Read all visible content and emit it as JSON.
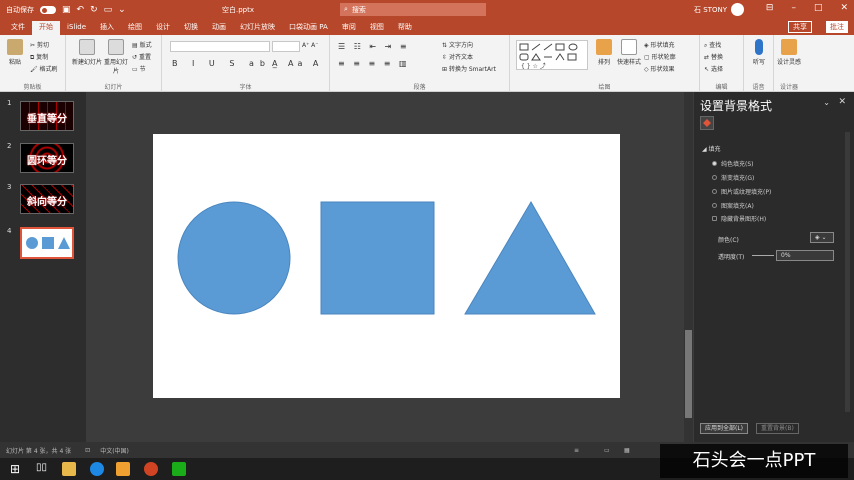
{
  "app": {
    "title": "空白.pptx",
    "user": "石 STONY",
    "search_placeholder": "搜索",
    "autosave_label": "自动保存"
  },
  "tabs": [
    "文件",
    "开始",
    "iSlide",
    "插入",
    "绘图",
    "设计",
    "切换",
    "动画",
    "幻灯片放映",
    "口袋动画 PA",
    "审阅",
    "视图",
    "帮助"
  ],
  "active_tab": "开始",
  "actions": {
    "share": "共享",
    "comment": "批注"
  },
  "ribbon": {
    "groups": [
      "剪贴板",
      "幻灯片",
      "字体",
      "段落",
      "绘图",
      "编辑"
    ],
    "clipboard": {
      "paste": "粘贴",
      "cut": "剪切",
      "copy": "复制",
      "format_painter": "格式刷"
    },
    "slides": {
      "new_slide": "新建幻灯片",
      "reuse": "重用幻灯片",
      "layout": "版式",
      "reset": "重置",
      "section": "节"
    },
    "paragraph": {
      "text_direction": "文字方向",
      "align_text": "对齐文本",
      "smartart": "转换为 SmartArt"
    },
    "drawing": {
      "arrange": "排列",
      "quick_styles": "快速样式",
      "shape_fill": "形状填充",
      "shape_outline": "形状轮廓",
      "shape_effects": "形状效果"
    },
    "editing": {
      "find": "查找",
      "replace": "替换",
      "select": "选择"
    },
    "voice": {
      "dictate": "听写",
      "label": "语音"
    },
    "design": {
      "ideas": "设计灵感",
      "label": "设计器"
    }
  },
  "slides": [
    {
      "num": "1",
      "title": "垂直等分"
    },
    {
      "num": "2",
      "title": "圆环等分"
    },
    {
      "num": "3",
      "title": "斜向等分"
    },
    {
      "num": "4",
      "title": ""
    }
  ],
  "pane": {
    "title": "设置背景格式",
    "section": "填充",
    "options": [
      "纯色填充(S)",
      "渐变填充(G)",
      "图片或纹理填充(P)",
      "图案填充(A)",
      "隐藏背景图形(H)"
    ],
    "color_label": "颜色(C)",
    "transparency_label": "透明度(T)",
    "transparency_value": "0%",
    "apply_all": "应用到全部(L)",
    "reset": "重置背景(B)"
  },
  "status": {
    "slide_info": "幻灯片 第 4 张，共 4 张",
    "language": "中文(中国)"
  },
  "watermark": "石头会一点PPT",
  "colors": {
    "accent": "#b7472a",
    "shape_fill": "#5b9bd5"
  }
}
